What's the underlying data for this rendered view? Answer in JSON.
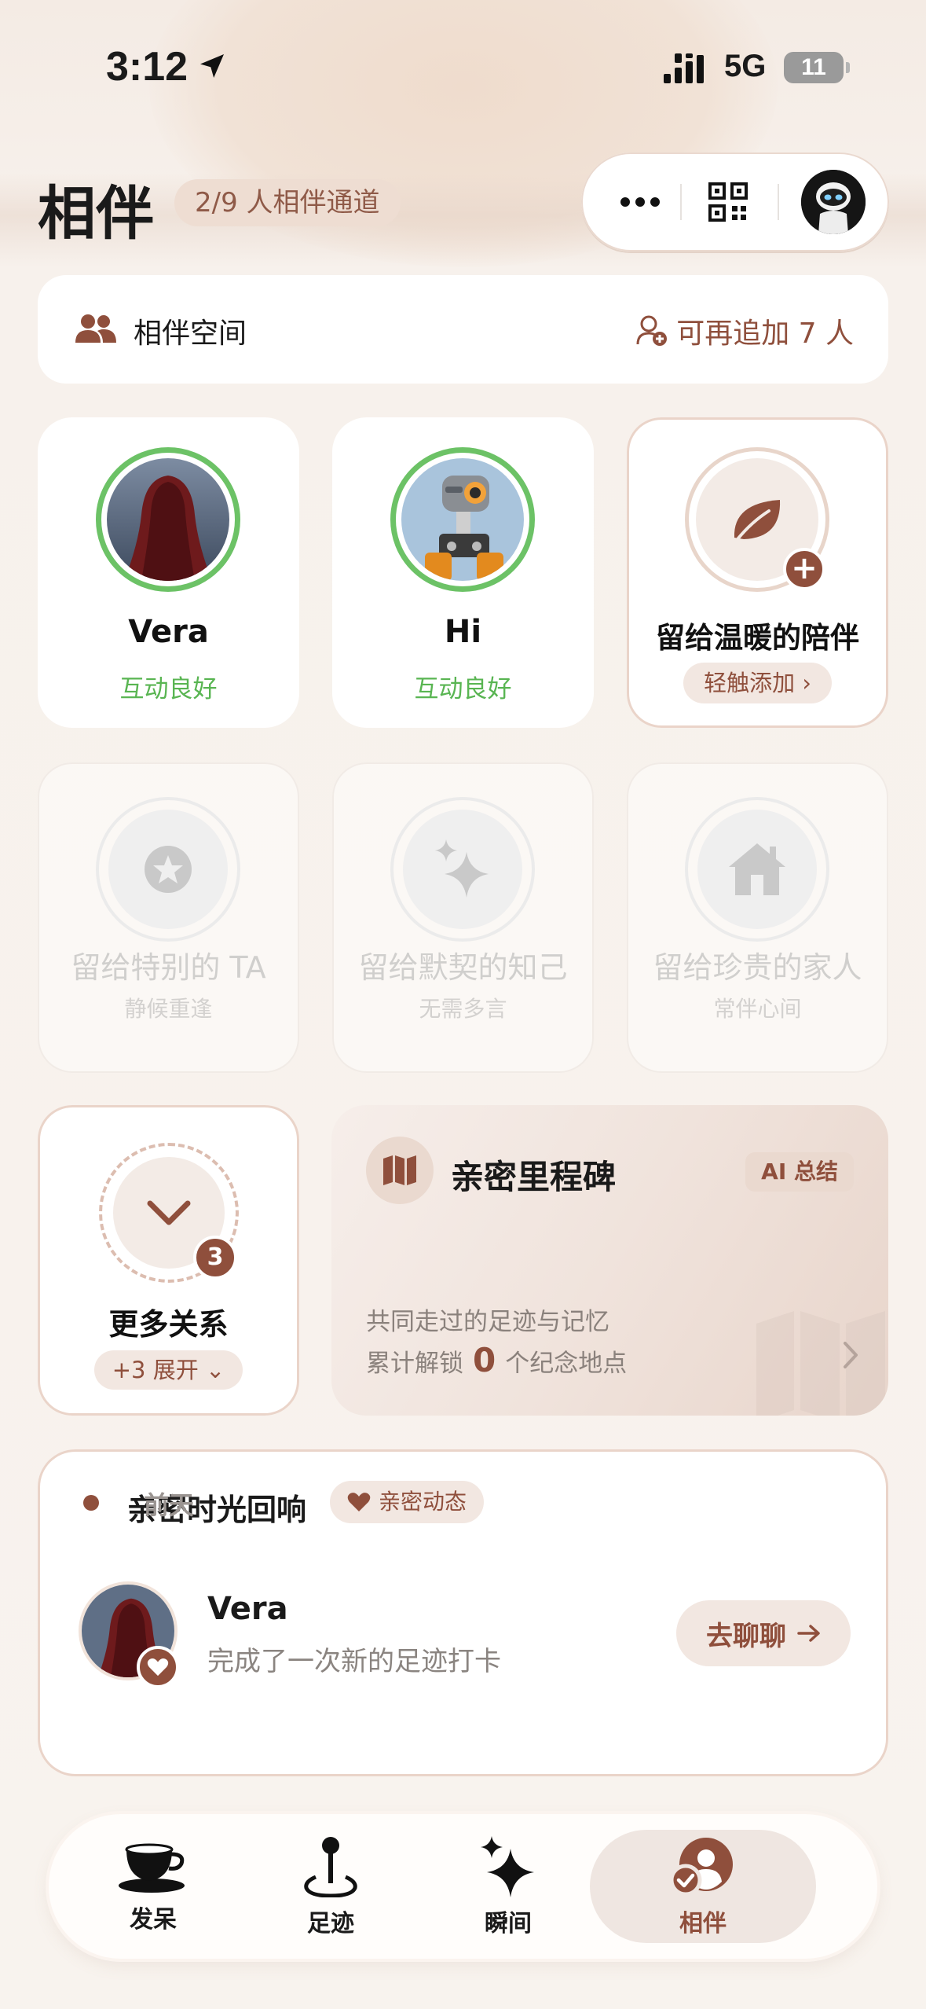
{
  "status_bar": {
    "time": "3:12",
    "network": "5G",
    "battery": "11"
  },
  "header": {
    "title": "相伴",
    "channel_badge": "2/9 人相伴通道"
  },
  "space": {
    "label": "相伴空间",
    "add_label": "可再追加 7 人"
  },
  "companions": [
    {
      "name": "Vera",
      "status": "互动良好"
    },
    {
      "name": "Hi",
      "status": "互动良好"
    }
  ],
  "add_card": {
    "name": "留给温暖的陪伴",
    "button": "轻触添加"
  },
  "placeholders": [
    {
      "name": "留给特别的 TA",
      "sub": "静候重逢",
      "icon": "star-icon"
    },
    {
      "name": "留给默契的知己",
      "sub": "无需多言",
      "icon": "sparkle-icon"
    },
    {
      "name": "留给珍贵的家人",
      "sub": "常伴心间",
      "icon": "house-icon"
    }
  ],
  "more_relations": {
    "count": "3",
    "name": "更多关系",
    "button": "+3 展开"
  },
  "milestone": {
    "title": "亲密里程碑",
    "ai_label": "AI 总结",
    "desc": "共同走过的足迹与记忆",
    "stat_prefix": "累计解锁",
    "stat_value": "0",
    "stat_suffix": "个纪念地点"
  },
  "echo": {
    "title": "亲密时光回响",
    "tag": "亲密动态",
    "time": "前天",
    "user": "Vera",
    "action": "完成了一次新的足迹打卡",
    "chat_button": "去聊聊"
  },
  "tabs": [
    {
      "label": "发呆",
      "icon": "coffee-cup-icon"
    },
    {
      "label": "足迹",
      "icon": "location-pin-icon"
    },
    {
      "label": "瞬间",
      "icon": "sparkle-icon"
    },
    {
      "label": "相伴",
      "icon": "companion-icon",
      "active": true
    }
  ],
  "colors": {
    "accent": "#8f4f3c",
    "good": "#59b552",
    "ring_green": "#6cc266"
  }
}
